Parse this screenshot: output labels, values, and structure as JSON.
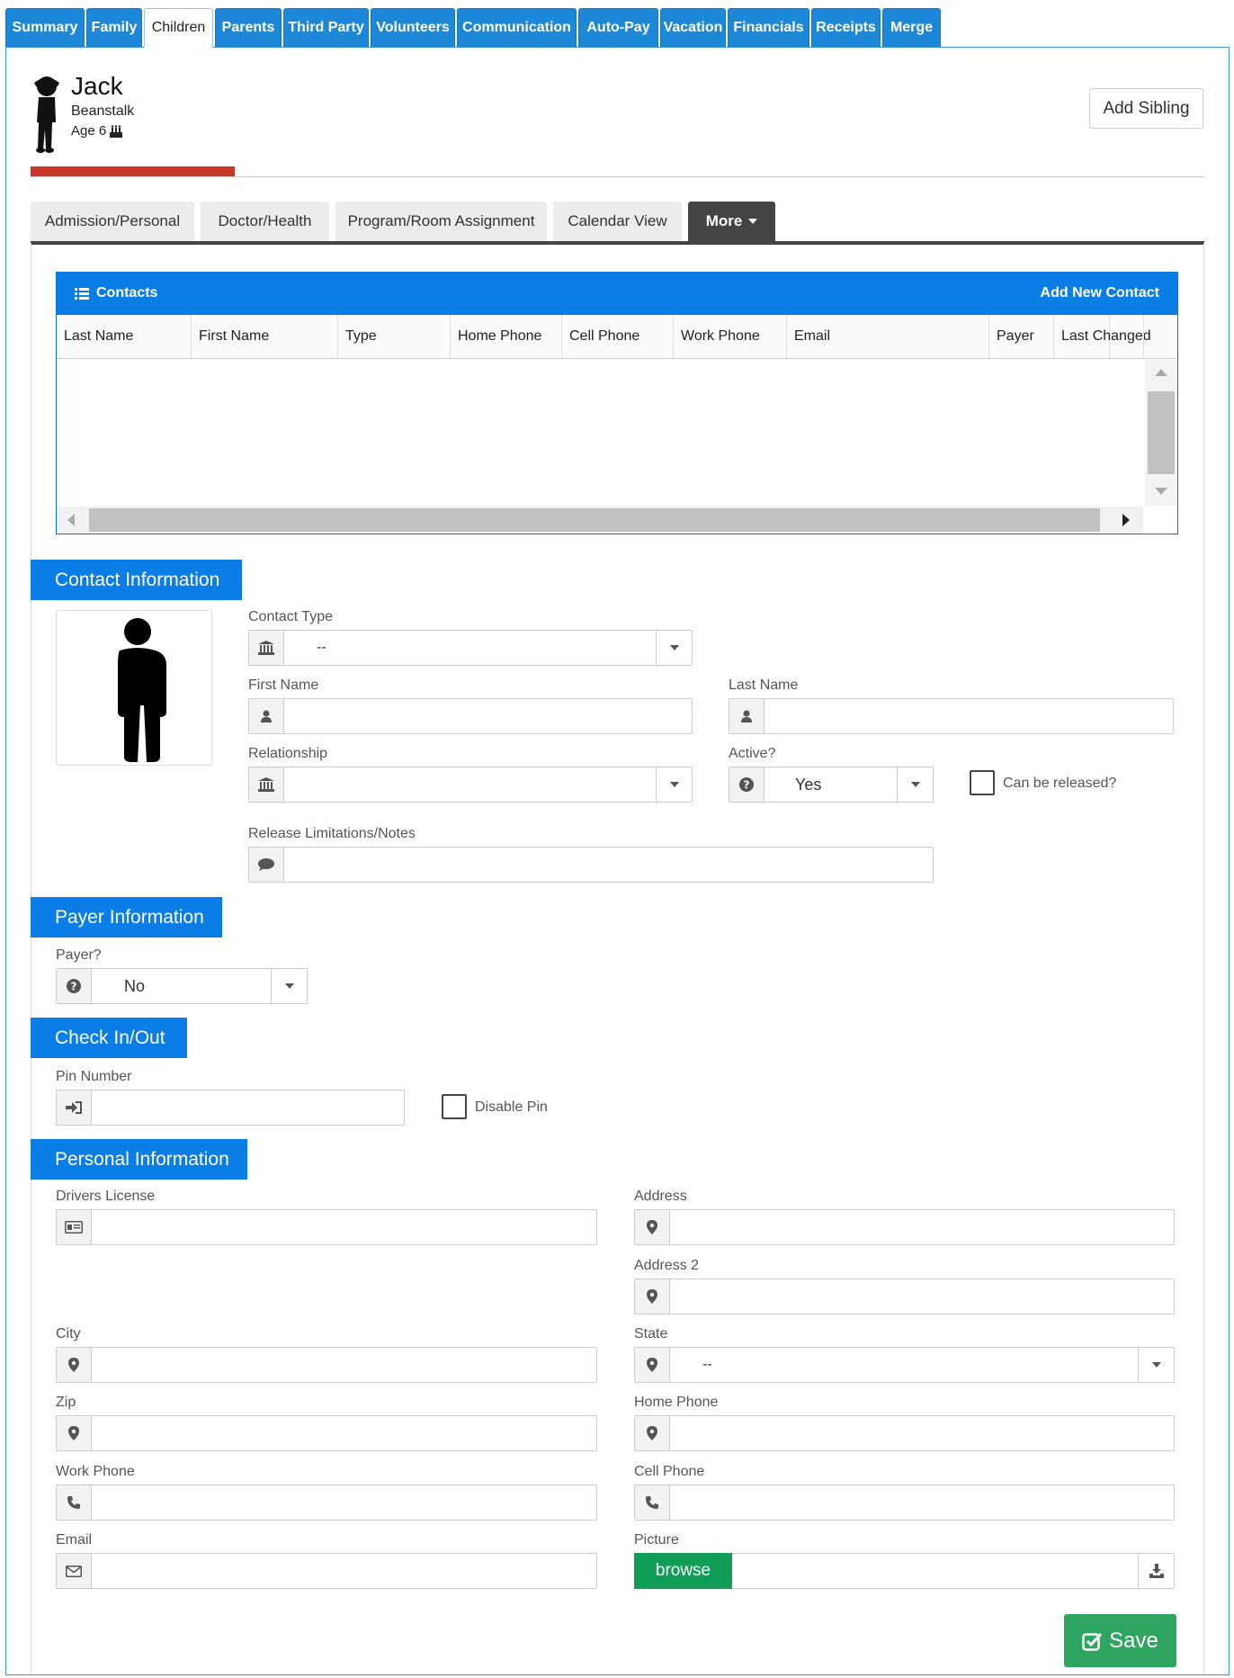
{
  "top_tabs": [
    "Summary",
    "Family",
    "Children",
    "Parents",
    "Third Party",
    "Volunteers",
    "Communication",
    "Auto-Pay",
    "Vacation",
    "Financials",
    "Receipts",
    "Merge"
  ],
  "active_top_tab": "Children",
  "child": {
    "first_name": "Jack",
    "last_name": "Beanstalk",
    "age": "Age 6"
  },
  "add_sibling_label": "Add Sibling",
  "sub_tabs": [
    "Admission/Personal",
    "Doctor/Health",
    "Program/Room Assignment",
    "Calendar View"
  ],
  "more_label": "More",
  "contacts": {
    "title": "Contacts",
    "add_new": "Add New Contact",
    "columns": [
      "Last Name",
      "First Name",
      "Type",
      "Home Phone",
      "Cell Phone",
      "Work Phone",
      "Email",
      "Payer",
      "Last Changed"
    ]
  },
  "sections": {
    "contact_info": "Contact Information",
    "payer_info": "Payer Information",
    "check_in_out": "Check In/Out",
    "personal_info": "Personal Information"
  },
  "form": {
    "contact_type_label": "Contact Type",
    "contact_type_value": "--",
    "first_name_label": "First Name",
    "last_name_label": "Last Name",
    "relationship_label": "Relationship",
    "active_label": "Active?",
    "active_value": "Yes",
    "can_be_released_label": "Can be released?",
    "release_notes_label": "Release Limitations/Notes",
    "payer_label": "Payer?",
    "payer_value": "No",
    "pin_label": "Pin Number",
    "disable_pin_label": "Disable Pin",
    "drivers_license_label": "Drivers License",
    "address_label": "Address",
    "address2_label": "Address 2",
    "city_label": "City",
    "state_label": "State",
    "state_value": "--",
    "zip_label": "Zip",
    "home_phone_label": "Home Phone",
    "work_phone_label": "Work Phone",
    "cell_phone_label": "Cell Phone",
    "email_label": "Email",
    "picture_label": "Picture",
    "browse_label": "browse",
    "save_label": "Save"
  },
  "colors": {
    "tab_blue": "#1d88d8",
    "header_blue": "#0a7ee6",
    "save_green": "#2ea561",
    "accent_red": "#c9362b"
  }
}
